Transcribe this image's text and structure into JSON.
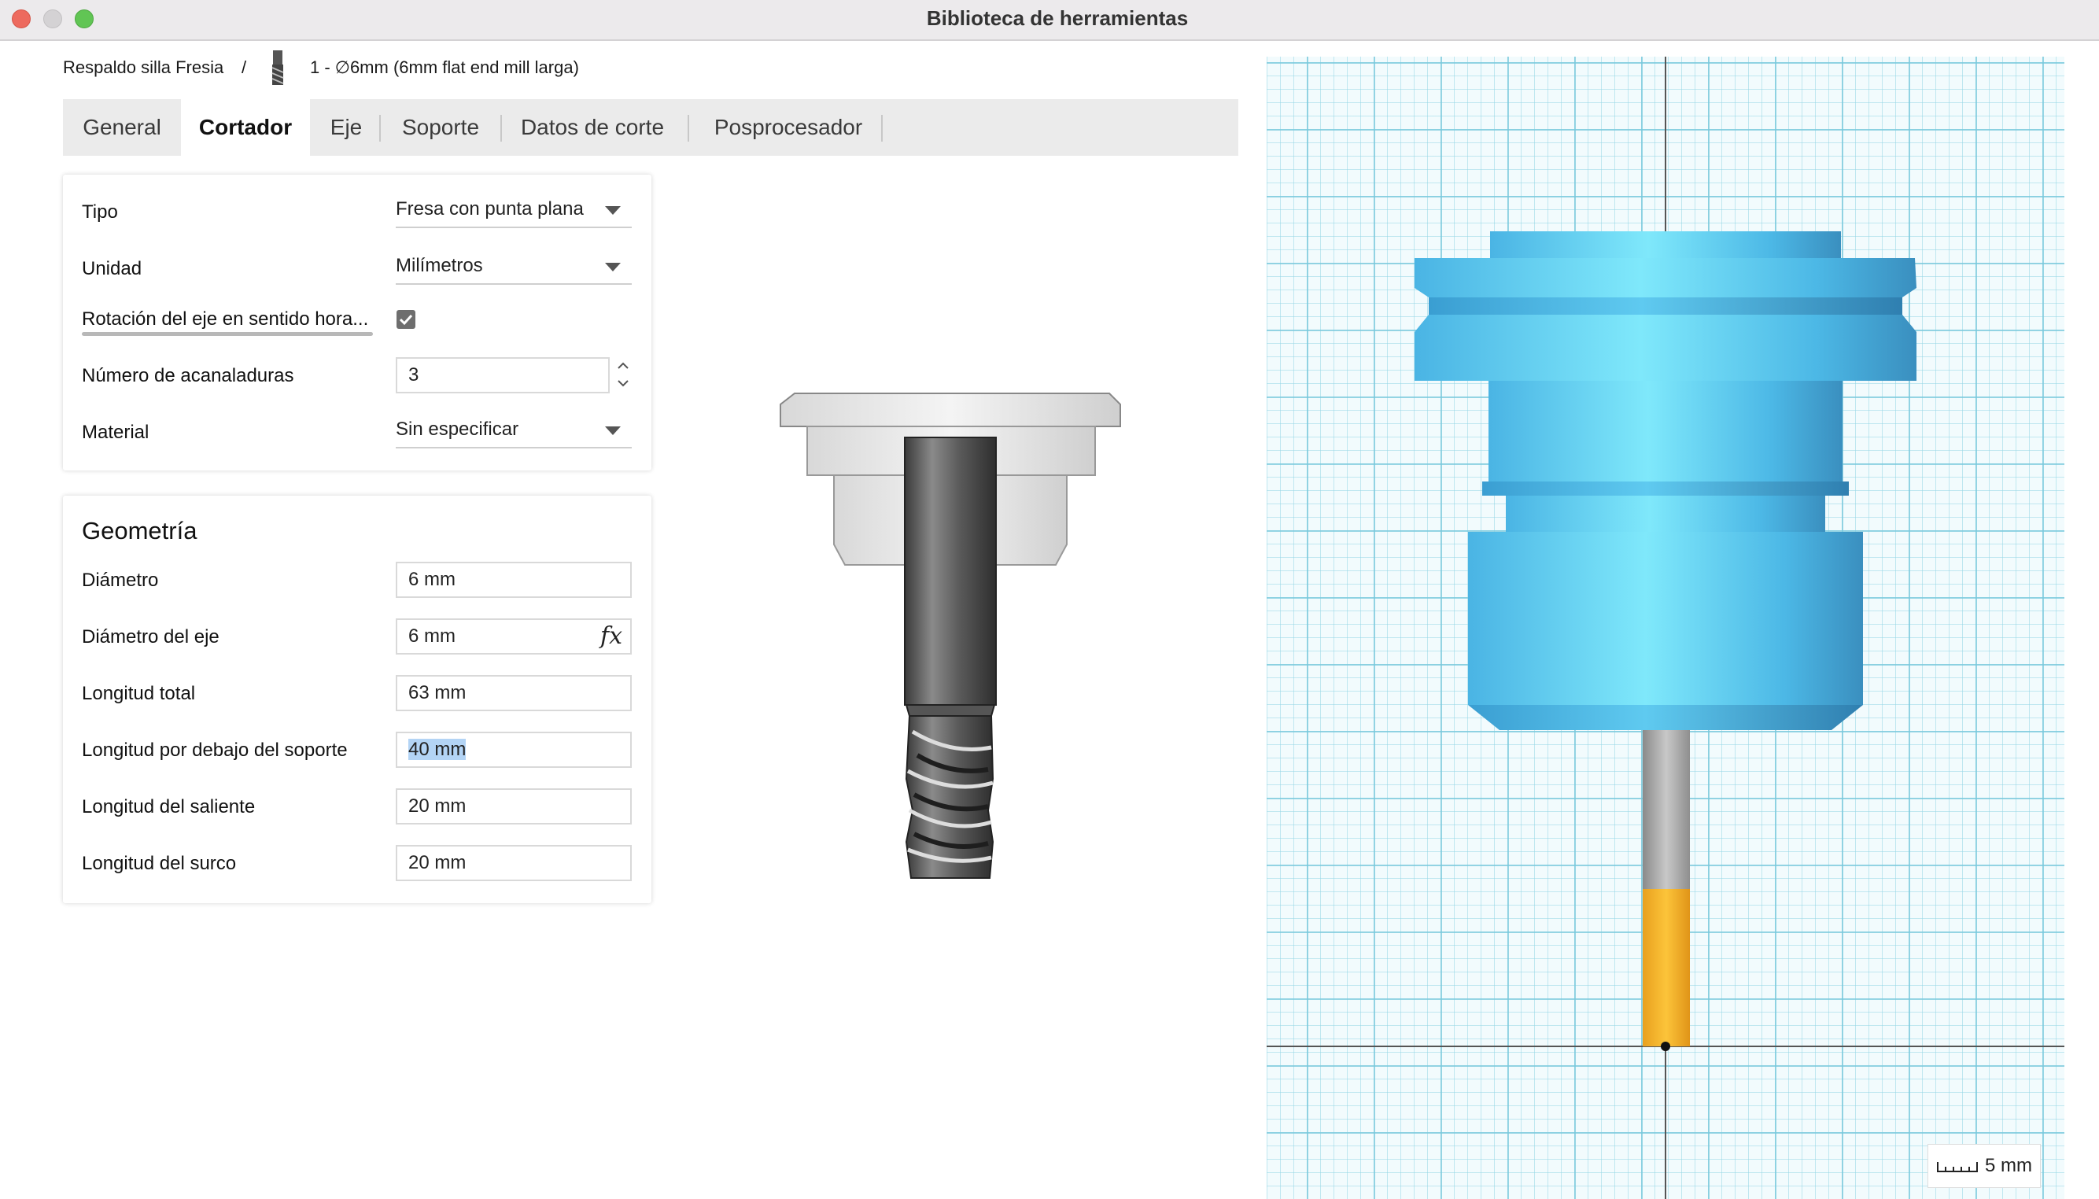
{
  "window": {
    "title": "Biblioteca de herramientas",
    "controls": [
      "close",
      "minimize",
      "zoom"
    ]
  },
  "breadcrumb": {
    "library": "Respaldo silla Fresia",
    "separator": "/",
    "tool": "1 - ∅6mm (6mm flat end mill larga)",
    "tool_icon": "end-mill-icon"
  },
  "tabs": [
    {
      "label": "General"
    },
    {
      "label": "Cortador",
      "active": true
    },
    {
      "label": "Eje"
    },
    {
      "label": "Soporte"
    },
    {
      "label": "Datos de corte"
    },
    {
      "label": "Posprocesador"
    }
  ],
  "cutter": {
    "type": {
      "label": "Tipo",
      "value": "Fresa con punta plana"
    },
    "unit": {
      "label": "Unidad",
      "value": "Milímetros"
    },
    "clockwise": {
      "label": "Rotación del eje en sentido hora...",
      "checked": true
    },
    "flutes": {
      "label": "Número de acanaladuras",
      "value": "3"
    },
    "material": {
      "label": "Material",
      "value": "Sin especificar"
    }
  },
  "geometry": {
    "title": "Geometría",
    "diameter": {
      "label": "Diámetro",
      "value": "6 mm"
    },
    "shaft_diameter": {
      "label": "Diámetro del eje",
      "value": "6 mm",
      "formula_icon": "fx"
    },
    "overall_length": {
      "label": "Longitud total",
      "value": "63 mm"
    },
    "length_below_holder": {
      "label": "Longitud por debajo del soporte",
      "value": "40 mm"
    },
    "shoulder_length": {
      "label": "Longitud del saliente",
      "value": "20 mm"
    },
    "flute_length": {
      "label": "Longitud del surco",
      "value": "20 mm"
    }
  },
  "viewport": {
    "scale_label": "5 mm",
    "holder_color": "#5bc8ee",
    "flute_color": "#f5b52a",
    "shank_color": "#a8a8a8"
  }
}
